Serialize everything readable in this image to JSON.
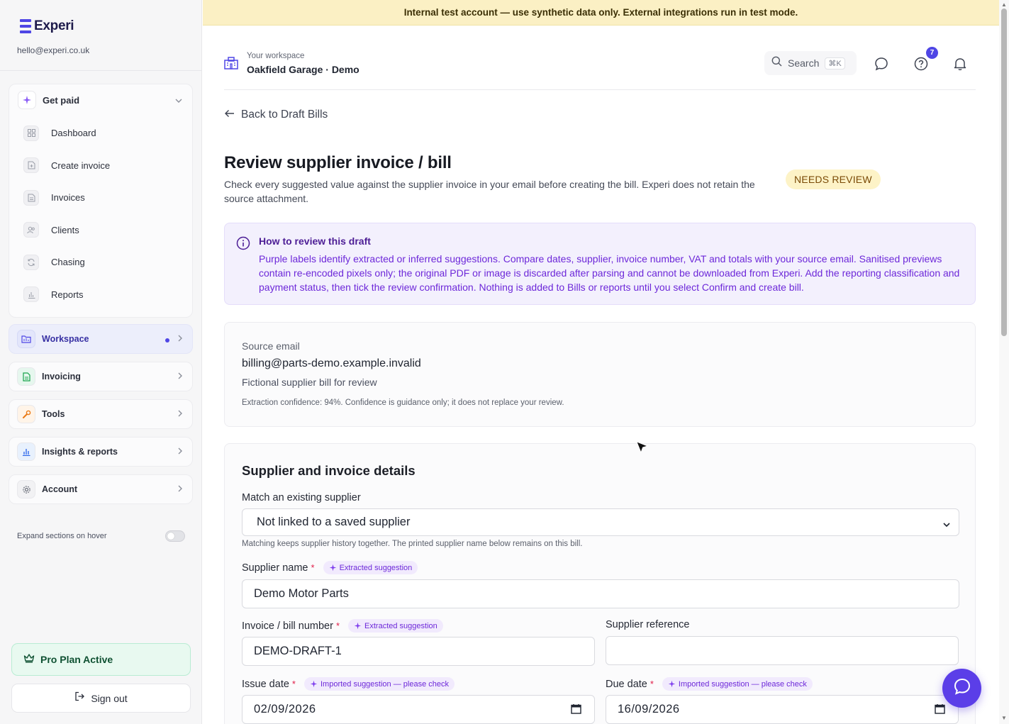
{
  "app": {
    "name": "Experi",
    "user_email": "hello@experi.co.uk",
    "accent": "#4f46e5"
  },
  "banner": {
    "text": "Internal test account — use synthetic data only. External integrations run in test mode."
  },
  "sidebar": {
    "get_paid": {
      "label": "Get paid",
      "items": [
        {
          "label": "Dashboard",
          "icon": "grid-icon"
        },
        {
          "label": "Create invoice",
          "icon": "file-plus-icon"
        },
        {
          "label": "Invoices",
          "icon": "file-text-icon"
        },
        {
          "label": "Clients",
          "icon": "users-icon"
        },
        {
          "label": "Chasing",
          "icon": "refresh-icon"
        },
        {
          "label": "Reports",
          "icon": "bar-chart-icon"
        }
      ]
    },
    "sections": [
      {
        "label": "Workspace",
        "icon": "folder-icon",
        "active": true
      },
      {
        "label": "Invoicing",
        "icon": "document-icon"
      },
      {
        "label": "Tools",
        "icon": "wrench-icon"
      },
      {
        "label": "Insights & reports",
        "icon": "bar-chart-icon"
      },
      {
        "label": "Account",
        "icon": "gear-icon"
      }
    ],
    "expand_toggle": {
      "label": "Expand sections on hover",
      "on": false
    },
    "plan": {
      "label": "Pro Plan Active"
    },
    "sign_out": {
      "label": "Sign out"
    }
  },
  "header": {
    "workspace_caption": "Your workspace",
    "workspace_name": "Oakfield Garage · Demo",
    "search_label": "Search",
    "search_shortcut": "⌘K",
    "help_badge": "7"
  },
  "page": {
    "back_label": "Back to Draft Bills",
    "title": "Review supplier invoice / bill",
    "subtitle": "Check every suggested value against the supplier invoice in your email before creating the bill. Experi does not retain the source attachment.",
    "status": "NEEDS REVIEW"
  },
  "info": {
    "title": "How to review this draft",
    "text": "Purple labels identify extracted or inferred suggestions. Compare dates, supplier, invoice number, VAT and totals with your source email. Sanitised previews contain re-encoded pixels only; the original PDF or image is discarded after parsing and cannot be downloaded from Experi. Add the reporting classification and payment status, then tick the review confirmation. Nothing is added to Bills or reports until you select Confirm and create bill."
  },
  "source": {
    "label": "Source email",
    "email": "billing@parts-demo.example.invalid",
    "description": "Fictional supplier bill for review",
    "confidence": "Extraction confidence: 94%. Confidence is guidance only; it does not replace your review."
  },
  "details": {
    "title": "Supplier and invoice details",
    "match_label": "Match an existing supplier",
    "match_value": "Not linked to a saved supplier",
    "match_help": "Matching keeps supplier history together. The printed supplier name below remains on this bill.",
    "supplier_name_label": "Supplier name",
    "supplier_name_value": "Demo Motor Parts",
    "extracted_pill": "Extracted suggestion",
    "imported_pill": "Imported suggestion — please check",
    "invoice_number_label": "Invoice / bill number",
    "invoice_number_value": "DEMO-DRAFT-1",
    "supplier_ref_label": "Supplier reference",
    "supplier_ref_value": "",
    "issue_date_label": "Issue date",
    "issue_date_value": "02/09/2026",
    "due_date_label": "Due date",
    "due_date_value": "16/09/2026",
    "required_mark": "*"
  },
  "colors": {
    "banner": "#fbf0c4",
    "suggestion": "#6d28d9",
    "plan": "#e8f9f0",
    "chat_button": "#5b3ee8"
  }
}
